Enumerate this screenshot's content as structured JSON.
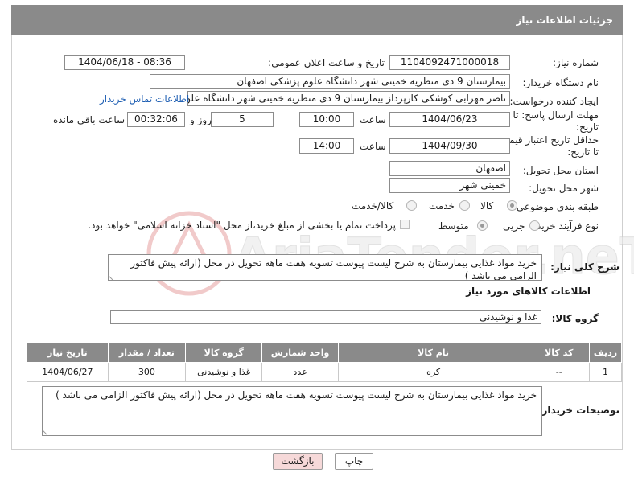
{
  "header": {
    "title": "جزئیات اطلاعات نیاز"
  },
  "form": {
    "need_number": {
      "label": "شماره نیاز:",
      "value": "1104092471000018"
    },
    "announce": {
      "label": "تاریخ و ساعت اعلان عمومی:",
      "value": "1404/06/18 - 08:36"
    },
    "buyer_org": {
      "label": "نام دستگاه خریدار:",
      "value": "بیمارستان 9 دی منظریه خمینی شهر دانشگاه علوم پزشکی اصفهان"
    },
    "requester": {
      "label": "ایجاد کننده درخواست:",
      "value": "ناصر مهرابی کوشکی کارپرداز بیمارستان 9 دی منظریه خمینی شهر دانشگاه علو",
      "contact_link": "اطلاعات تماس خریدار"
    },
    "reply_deadline": {
      "label_line1": "مهلت ارسال پاسخ: تا",
      "label_line2": "تاریخ:",
      "date": "1404/06/23",
      "time_label": "ساعت",
      "time": "10:00",
      "days": "5",
      "days_label": "روز و",
      "remaining": "00:32:06",
      "remaining_label": "ساعت باقی مانده"
    },
    "price_validity": {
      "label_line1": "حداقل تاریخ اعتبار قیمت:",
      "label_line2": "تا تاریخ:",
      "date": "1404/09/30",
      "time_label": "ساعت",
      "time": "14:00"
    },
    "province": {
      "label": "استان محل تحویل:",
      "value": "اصفهان"
    },
    "city": {
      "label": "شهر محل تحویل:",
      "value": "خمینی شهر"
    },
    "category": {
      "label": "طبقه بندی موضوعی:",
      "options": [
        "کالا",
        "خدمت",
        "کالا/خدمت"
      ],
      "selected": "کالا"
    },
    "purchase_process": {
      "label": "نوع فرآیند خرید :",
      "options": [
        "جزیی",
        "متوسط"
      ],
      "selected": "متوسط",
      "treasury_note": "پرداخت تمام یا بخشی از مبلغ خرید،از محل \"اسناد خزانه اسلامی\" خواهد بود."
    },
    "general_description": {
      "label": "شرح کلی نیاز:",
      "value": "خرید مواد غذایی بیمارستان به شرح لیست پیوست تسویه هفت ماهه تحویل در محل (ارائه پیش فاکتور الزامی می باشد )"
    }
  },
  "goods": {
    "section_title": "اطلاعات کالاهای مورد نیاز",
    "group_label": "گروه کالا:",
    "group_value": "غذا و نوشیدنی",
    "columns": [
      "ردیف",
      "کد کالا",
      "نام کالا",
      "واحد شمارش",
      "گروه کالا",
      "تعداد / مقدار",
      "تاریخ نیاز"
    ],
    "rows": [
      [
        "1",
        "--",
        "کره",
        "عدد",
        "غذا و نوشیدنی",
        "300",
        "1404/06/27"
      ]
    ]
  },
  "buyer_notes": {
    "label": "توضیحات خریدار:",
    "value": "خرید مواد غذایی بیمارستان به شرح لیست پیوست تسویه هفت ماهه تحویل در محل (ارائه پیش فاکتور الزامی می باشد )"
  },
  "buttons": {
    "print": "چاپ",
    "back": "بازگشت"
  },
  "watermark_text": "AriaTender.neT",
  "colors": {
    "header_bg": "#8a8a8a",
    "back_button_bg": "#f6d9d9",
    "link": "#1f5fb3"
  }
}
